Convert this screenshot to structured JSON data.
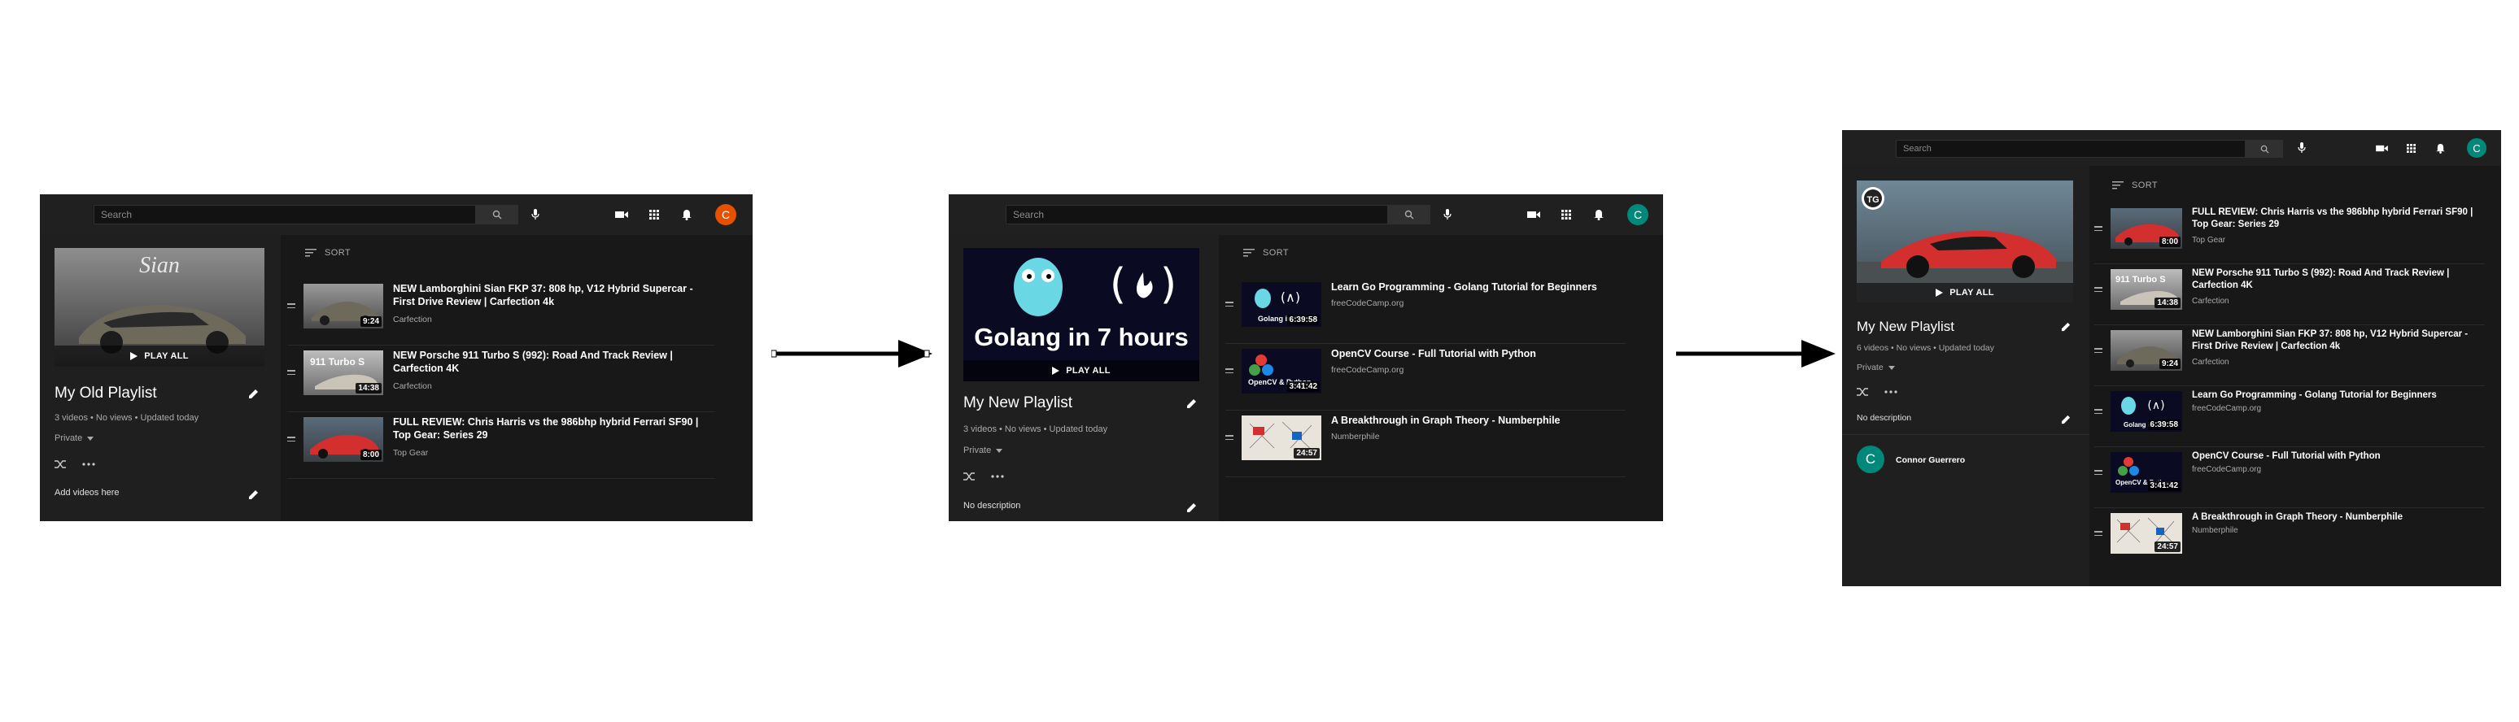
{
  "colors": {
    "accent_orange": "#e65100",
    "accent_teal": "#00897b",
    "bg_dark": "#181818",
    "sidebar": "#1f1f1f"
  },
  "panel1": {
    "search_placeholder": "Search",
    "avatar_letter": "C",
    "hero_label": "PLAY ALL",
    "title": "My Old Playlist",
    "meta": "3 videos • No views • Updated today",
    "privacy": "Private",
    "note": "Add videos here",
    "sort_label": "SORT",
    "videos": [
      {
        "title": "NEW Lamborghini Sian FKP 37: 808 hp, V12 Hybrid Supercar - First Drive Review | Carfection 4k",
        "channel": "Carfection",
        "duration": "9:24"
      },
      {
        "title": "NEW Porsche 911 Turbo S (992): Road And Track Review | Carfection 4K",
        "channel": "Carfection",
        "duration": "14:38"
      },
      {
        "title": "FULL REVIEW: Chris Harris vs the 986bhp hybrid Ferrari SF90 | Top Gear: Series 29",
        "channel": "Top Gear",
        "duration": "8:00"
      }
    ]
  },
  "panel2": {
    "search_placeholder": "Search",
    "avatar_letter": "C",
    "hero_label": "PLAY ALL",
    "hero_caption": "Golang in 7 hours",
    "title": "My New Playlist",
    "meta": "3 videos • No views • Updated today",
    "privacy": "Private",
    "note": "No description",
    "sort_label": "SORT",
    "videos": [
      {
        "title": "Learn Go Programming - Golang Tutorial for Beginners",
        "channel": "freeCodeCamp.org",
        "duration": "6:39:58"
      },
      {
        "title": "OpenCV Course - Full Tutorial with Python",
        "channel": "freeCodeCamp.org",
        "duration": "3:41:42"
      },
      {
        "title": "A Breakthrough in Graph Theory - Numberphile",
        "channel": "Numberphile",
        "duration": "24:57"
      }
    ]
  },
  "panel3": {
    "search_placeholder": "Search",
    "avatar_letter": "C",
    "hero_label": "PLAY ALL",
    "title": "My New Playlist",
    "meta": "6 videos • No views • Updated today",
    "privacy": "Private",
    "note": "No description",
    "owner": "Connor Guerrero",
    "owner_letter": "C",
    "sort_label": "SORT",
    "videos": [
      {
        "title": "FULL REVIEW: Chris Harris vs the 986bhp hybrid Ferrari SF90 | Top Gear: Series 29",
        "channel": "Top Gear",
        "duration": "8:00"
      },
      {
        "title": "NEW Porsche 911 Turbo S (992): Road And Track Review | Carfection 4K",
        "channel": "Carfection",
        "duration": "14:38"
      },
      {
        "title": "NEW Lamborghini Sian FKP 37: 808 hp, V12 Hybrid Supercar - First Drive Review | Carfection 4k",
        "channel": "Carfection",
        "duration": "9:24"
      },
      {
        "title": "Learn Go Programming - Golang Tutorial for Beginners",
        "channel": "freeCodeCamp.org",
        "duration": "6:39:58"
      },
      {
        "title": "OpenCV Course - Full Tutorial with Python",
        "channel": "freeCodeCamp.org",
        "duration": "3:41:42"
      },
      {
        "title": "A Breakthrough in Graph Theory - Numberphile",
        "channel": "Numberphile",
        "duration": "24:57"
      }
    ]
  }
}
